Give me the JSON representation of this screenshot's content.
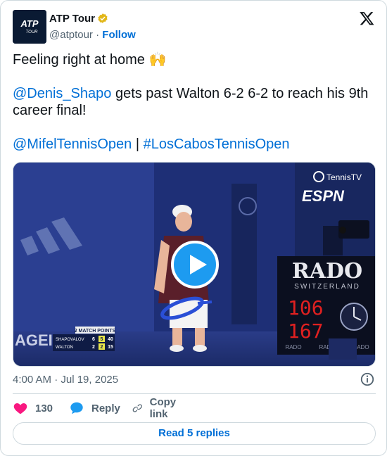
{
  "colors": {
    "link": "#006fd6",
    "text": "#0f1419",
    "secondary": "#536471",
    "border": "#cfd9de",
    "like": "#f91880",
    "play": "#1d9bf0"
  },
  "author": {
    "avatar_text_top": "ATP",
    "avatar_text_bottom": "TOUR",
    "display_name": "ATP Tour",
    "handle": "@atptour",
    "separator": "·",
    "follow_label": "Follow",
    "verified_icon": "verified-badge-icon"
  },
  "tweet": {
    "line1": "Feeling right at home 🙌",
    "mention": "@Denis_Shapo",
    "line2_rest": " gets past Walton 6-2 6-2 to reach his 9th career final!",
    "hashtag_mention": "@MifelTennisOpen",
    "pipe": " | ",
    "hashtag": "#LosCabosTennisOpen"
  },
  "media": {
    "overlay_brand": "TennisTV",
    "overlay_network": "ESPN",
    "board_brand": "RADO",
    "board_sub": "SWITZERLAND",
    "board_num1": "106",
    "board_num2": "167",
    "board_footer": [
      "RADO",
      "RADO",
      "RADO"
    ],
    "wall_text": "AGEI",
    "score_header": "2 MATCH POINTS",
    "score_rows": [
      {
        "player": "SHAPOVALOV",
        "s1": "6",
        "s2": "5",
        "pts": "40"
      },
      {
        "player": "WALTON",
        "s1": "2",
        "s2": "2",
        "pts": "15"
      }
    ],
    "play_icon": "play-icon"
  },
  "meta": {
    "timestamp": "4:00 AM · Jul 19, 2025",
    "info_icon": "info-icon"
  },
  "actions": {
    "like_count": "130",
    "reply_label": "Reply",
    "copy_label": "Copy link"
  },
  "footer": {
    "read_replies": "Read 5 replies"
  }
}
